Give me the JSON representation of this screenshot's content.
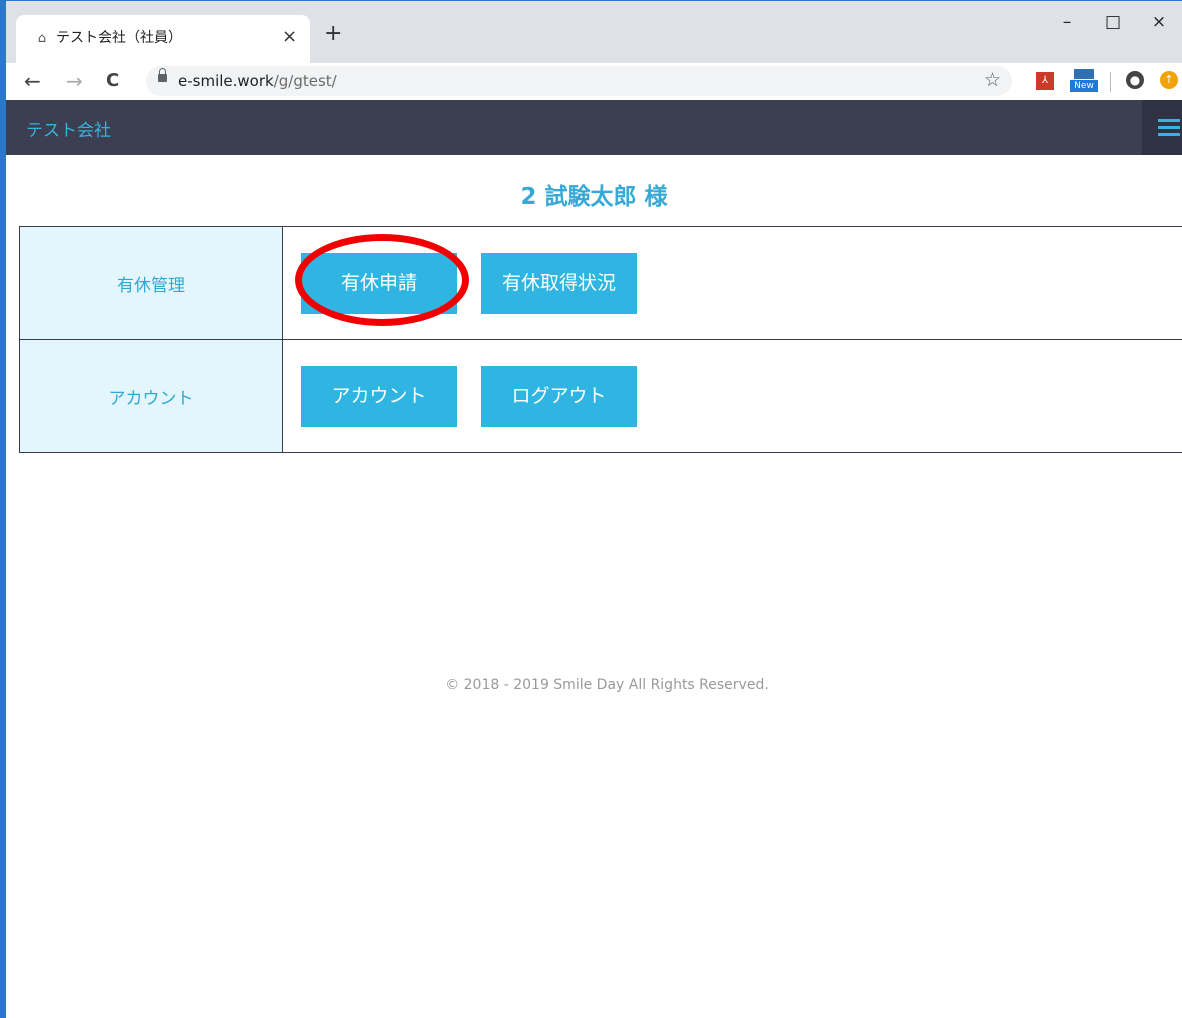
{
  "browser": {
    "tab_title": "テスト会社（社員）",
    "tab_close": "×",
    "new_tab": "+",
    "window_controls": {
      "minimize": "–",
      "maximize": "□",
      "close": "×"
    },
    "nav": {
      "back": "←",
      "forward": "→",
      "reload": "C"
    },
    "url_host": "e-smile.work",
    "url_path": "/g/gtest/",
    "bookmark_star": "☆",
    "extension_new_label": "New"
  },
  "site": {
    "name": "テスト会社"
  },
  "greeting": "2 試験太郎 様",
  "menu": {
    "rows": [
      {
        "label": "有休管理",
        "buttons": [
          "有休申請",
          "有休取得状況"
        ]
      },
      {
        "label": "アカウント",
        "buttons": [
          "アカウント",
          "ログアウト"
        ]
      }
    ]
  },
  "annotation": {
    "highlight_color": "#f00000",
    "highlight_target": "有休申請"
  },
  "colors": {
    "accent": "#30b5e2",
    "header_bg": "#3c3f51",
    "label_bg": "#e3f6fc"
  },
  "footer": "© 2018 - 2019 Smile Day All Rights Reserved."
}
